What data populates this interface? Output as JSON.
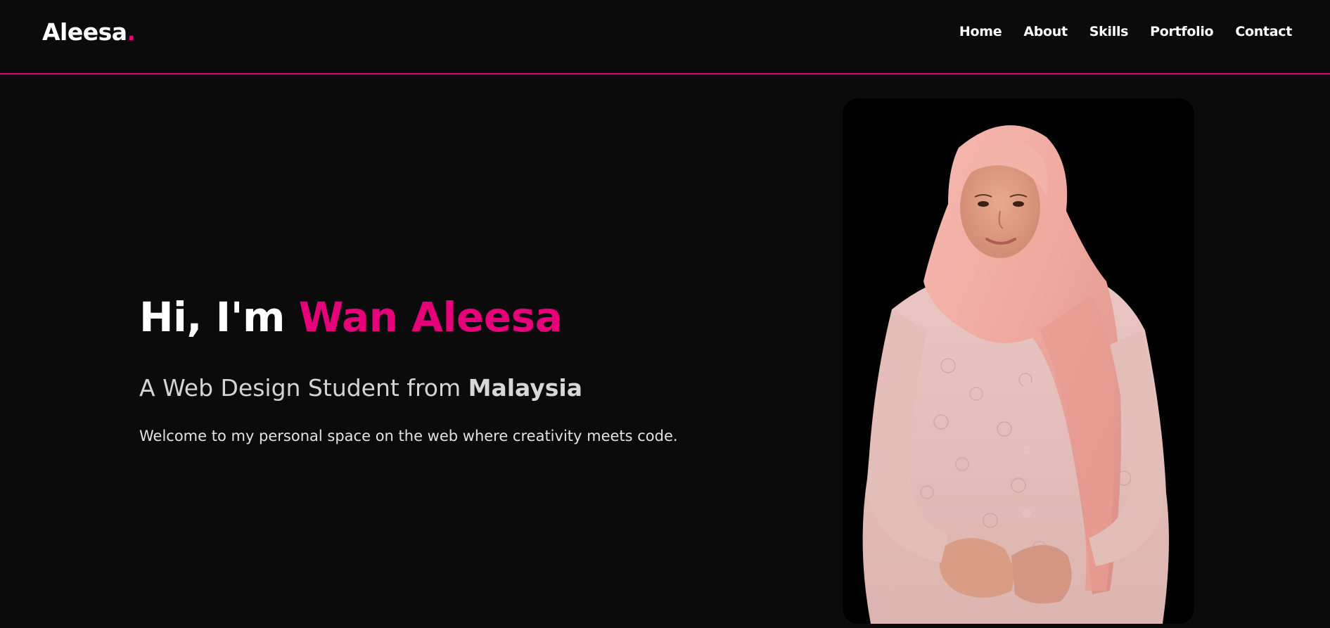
{
  "brand": {
    "logo_text": "Aleesa",
    "logo_dot": ".",
    "accent_color": "#e6007a"
  },
  "nav": {
    "items": [
      {
        "label": "Home"
      },
      {
        "label": "About"
      },
      {
        "label": "Skills"
      },
      {
        "label": "Portfolio"
      },
      {
        "label": "Contact"
      }
    ]
  },
  "hero": {
    "greeting": "Hi, I'm ",
    "name": "Wan Aleesa",
    "subtitle_prefix": "A Web Design Student from ",
    "subtitle_country": "Malaysia",
    "description": "Welcome to my personal space on the web where creativity meets code."
  },
  "colors": {
    "background": "#0b0b0c",
    "text": "#ffffff",
    "accent": "#e6007a"
  }
}
